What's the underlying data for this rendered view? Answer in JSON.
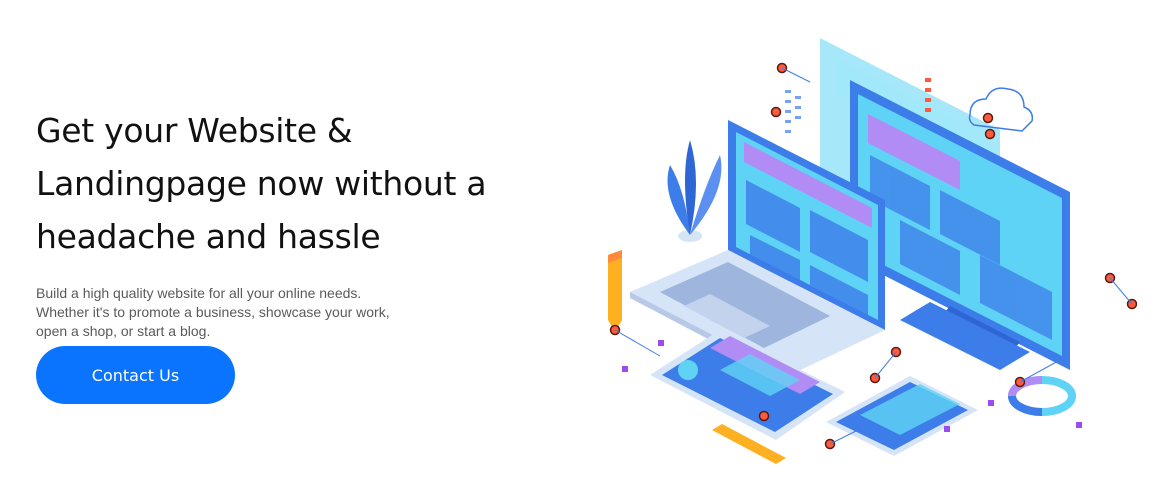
{
  "hero": {
    "headline_lines": [
      "Get your Website &",
      "Landingpage now without a",
      "headache and hassle"
    ],
    "description_lines": [
      "Build a high quality website for all your online needs.",
      "Whether it's to promote a business, showcase your work,",
      "open a shop, or start a blog."
    ],
    "cta_label": "Contact Us"
  },
  "colors": {
    "cta": "#0a74ff",
    "headline": "#111111",
    "body_text": "#5a5a5a",
    "illustration_primary": "#3d7dea",
    "illustration_accent": "#b28cf5",
    "illustration_screen": "#5fd3f5"
  },
  "illustration": {
    "icon": "isometric-devices-illustration"
  }
}
